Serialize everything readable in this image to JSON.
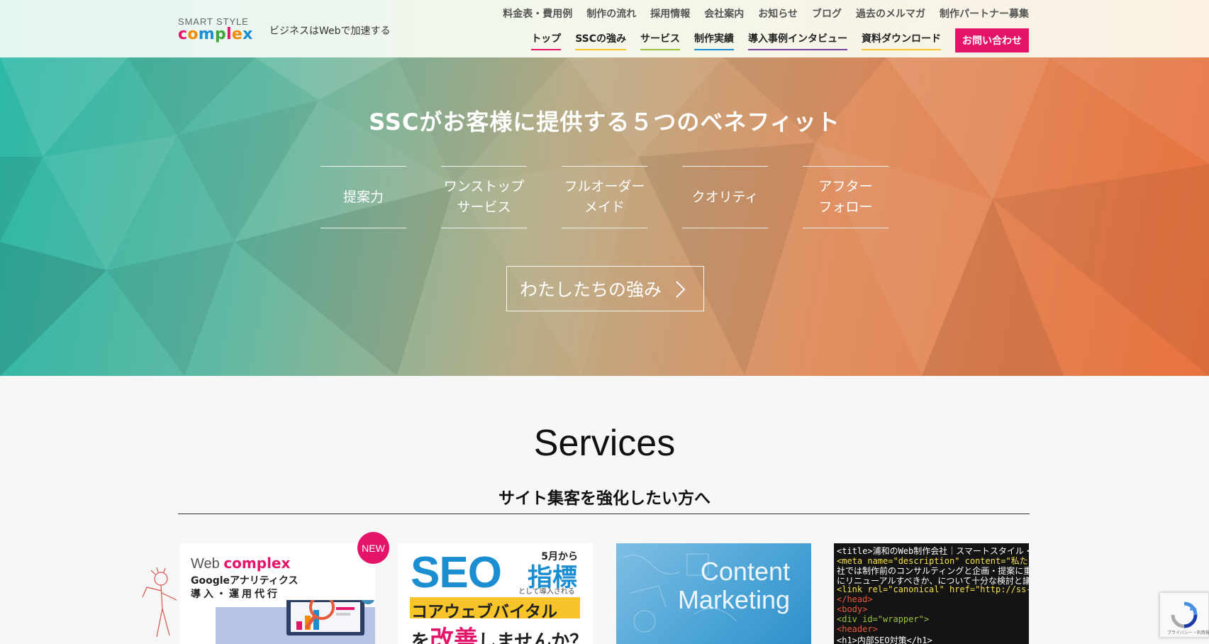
{
  "header": {
    "logo_top": "SMART STYLE",
    "logo_main_letters": [
      "c",
      "o",
      "m",
      "p",
      "l",
      "e",
      "x"
    ],
    "logo_colors": [
      "#e5146b",
      "#f08a00",
      "#1b8ed2",
      "#3aa935",
      "#e5146b",
      "#f08a00",
      "#1b8ed2"
    ],
    "tagline": "ビジネスはWebで加速する",
    "top_nav": [
      "料金表・費用例",
      "制作の流れ",
      "採用情報",
      "会社案内",
      "お知らせ",
      "ブログ",
      "過去のメルマガ",
      "制作パートナー募集"
    ],
    "main_nav": [
      {
        "label": "トップ",
        "underline": "#e5146b"
      },
      {
        "label": "SSCの強み",
        "underline": "#f7c52a"
      },
      {
        "label": "サービス",
        "underline": "#9bc53d"
      },
      {
        "label": "制作実績",
        "underline": "#1b8ed2"
      },
      {
        "label": "導入事例インタビュー",
        "underline": "#7b3fa0"
      },
      {
        "label": "資料ダウンロード",
        "underline": "#f7c52a"
      }
    ],
    "contact_label": "お問い合わせ",
    "accent_color": "#e5146b"
  },
  "hero": {
    "title": "SSCがお客様に提供する５つのベネフィット",
    "benefits": [
      "提案力",
      "ワンストップ\nサービス",
      "フルオーダー\nメイド",
      "クオリティ",
      "アフター\nフォロー"
    ],
    "button_label": "わたしたちの強み",
    "button_icon": "chevron-right-icon"
  },
  "services": {
    "title": "Services",
    "subtitle": "サイト集客を強化したい方へ",
    "new_badge": "NEW",
    "cards": [
      {
        "brand_prefix": "Web",
        "brand_name": "complex",
        "line1": "Googleアナリティクス",
        "line2": "導入・運用代行"
      },
      {
        "month": "5月から",
        "seo": "SEO",
        "index": "指標",
        "small": "として導入される",
        "cwv": "コアウェブバイタル",
        "last_prefix": "を",
        "last_red": "改善",
        "last_suffix": "しませんか？"
      },
      {
        "text": "Content\nMarketing"
      },
      {
        "code": [
          "<title>浦和のWeb制作会社｜スマートスタイル・コンプレックス",
          "<meta name=\"description\"  content=\"私たちは、「本質」を",
          "社では制作前のコンサルティングと企画・提案に重きをおいていま",
          "にリニューアルすべきか、について十分な検討と議論を行ったうえで",
          "<link rel=\"canonical\" href=\"http://ss-complex.com/\"",
          "</head>",
          "<body>",
          "  <div id=\"wrapper\">",
          "    <header>",
          "      <h1>内部SEO対策</h1>"
        ]
      }
    ]
  },
  "recaptcha": {
    "text": "プライバシー・利用規約"
  }
}
